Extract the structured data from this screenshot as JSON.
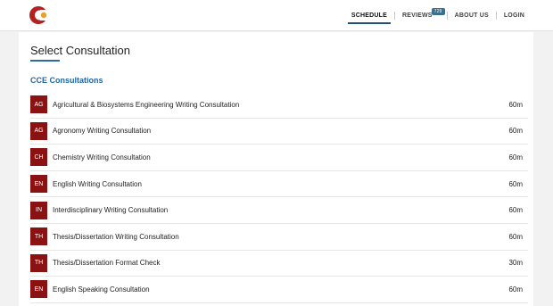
{
  "colors": {
    "accent": "#1f4e79",
    "brand_red": "#8b1212",
    "section_blue": "#2366a4",
    "logo_orange": "#e8a12a",
    "logo_red": "#b22222"
  },
  "logo": {
    "icon": "brand-logo-icon"
  },
  "nav": {
    "items": [
      {
        "label": "SCHEDULE",
        "active": true
      },
      {
        "label": "REVIEWS",
        "badge": "729"
      },
      {
        "label": "ABOUT US"
      },
      {
        "label": "LOGIN"
      }
    ]
  },
  "page": {
    "title": "Select Consultation",
    "section": "CCE Consultations"
  },
  "consultations": [
    {
      "abbr": "AG",
      "name": "Agricultural & Biosystems Engineering Writing Consultation",
      "duration": "60m"
    },
    {
      "abbr": "AG",
      "name": "Agronomy Writing Consultation",
      "duration": "60m"
    },
    {
      "abbr": "CH",
      "name": "Chemistry Writing Consultation",
      "duration": "60m"
    },
    {
      "abbr": "EN",
      "name": "English Writing Consultation",
      "duration": "60m"
    },
    {
      "abbr": "IN",
      "name": "Interdisciplinary Writing Consultation",
      "duration": "60m"
    },
    {
      "abbr": "TH",
      "name": "Thesis/Dissertation Writing Consultation",
      "duration": "60m"
    },
    {
      "abbr": "TH",
      "name": "Thesis/Dissertation Format Check",
      "duration": "30m"
    },
    {
      "abbr": "EN",
      "name": "English Speaking Consultation",
      "duration": "60m"
    }
  ]
}
